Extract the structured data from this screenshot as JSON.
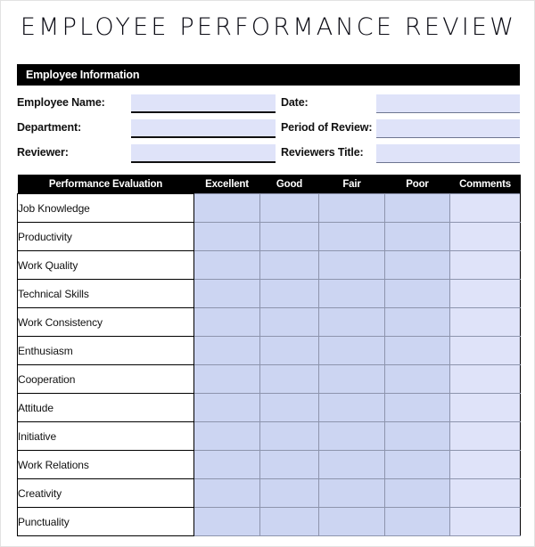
{
  "document": {
    "title": "EMPLOYEE  PERFORMANCE  REVIEW"
  },
  "employee_information": {
    "section_title": "Employee Information",
    "fields": [
      {
        "label": "Employee Name:",
        "value": "",
        "placeholder": ""
      },
      {
        "label": "Date:",
        "value": "",
        "placeholder": ""
      },
      {
        "label": "Department:",
        "value": "",
        "placeholder": ""
      },
      {
        "label": "Period of Review:",
        "value": "",
        "placeholder": ""
      },
      {
        "label": "Reviewer:",
        "value": "",
        "placeholder": ""
      },
      {
        "label": "Reviewers Title:",
        "value": "",
        "placeholder": ""
      }
    ]
  },
  "evaluation_table": {
    "columns": [
      "Performance Evaluation",
      "Excellent",
      "Good",
      "Fair",
      "Poor",
      "Comments"
    ],
    "rows": [
      {
        "criterion": "Job Knowledge",
        "excellent": "",
        "good": "",
        "fair": "",
        "poor": "",
        "comments": ""
      },
      {
        "criterion": "Productivity",
        "excellent": "",
        "good": "",
        "fair": "",
        "poor": "",
        "comments": ""
      },
      {
        "criterion": "Work Quality",
        "excellent": "",
        "good": "",
        "fair": "",
        "poor": "",
        "comments": ""
      },
      {
        "criterion": "Technical Skills",
        "excellent": "",
        "good": "",
        "fair": "",
        "poor": "",
        "comments": ""
      },
      {
        "criterion": "Work Consistency",
        "excellent": "",
        "good": "",
        "fair": "",
        "poor": "",
        "comments": ""
      },
      {
        "criterion": "Enthusiasm",
        "excellent": "",
        "good": "",
        "fair": "",
        "poor": "",
        "comments": ""
      },
      {
        "criterion": "Cooperation",
        "excellent": "",
        "good": "",
        "fair": "",
        "poor": "",
        "comments": ""
      },
      {
        "criterion": "Attitude",
        "excellent": "",
        "good": "",
        "fair": "",
        "poor": "",
        "comments": ""
      },
      {
        "criterion": "Initiative",
        "excellent": "",
        "good": "",
        "fair": "",
        "poor": "",
        "comments": ""
      },
      {
        "criterion": "Work Relations",
        "excellent": "",
        "good": "",
        "fair": "",
        "poor": "",
        "comments": ""
      },
      {
        "criterion": "Creativity",
        "excellent": "",
        "good": "",
        "fair": "",
        "poor": "",
        "comments": ""
      },
      {
        "criterion": "Punctuality",
        "excellent": "",
        "good": "",
        "fair": "",
        "poor": "",
        "comments": ""
      }
    ]
  },
  "colors": {
    "section_bar": "#000000",
    "field_fill": "#dfe3f9",
    "rating_cell": "#ccd5f2",
    "comment_cell": "#dfe3f9",
    "grid_line": "#8d94ad",
    "text": "#111111"
  }
}
